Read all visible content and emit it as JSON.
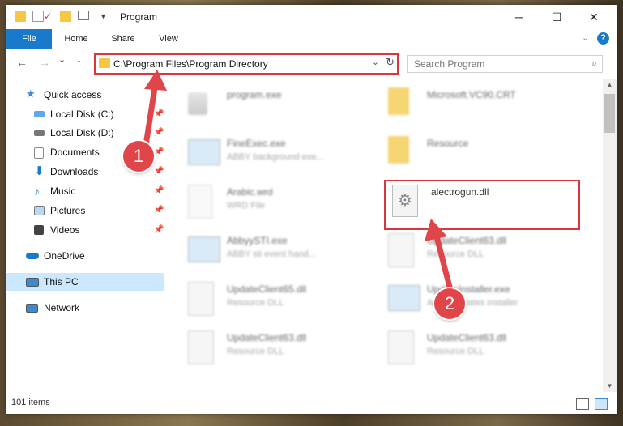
{
  "window": {
    "title": "Program",
    "controls": {
      "minimize": "─",
      "maximize": "☐",
      "close": "✕"
    }
  },
  "ribbon": {
    "tabs": [
      {
        "label": "File"
      },
      {
        "label": "Home"
      },
      {
        "label": "Share"
      },
      {
        "label": "View"
      }
    ],
    "help": "?"
  },
  "nav": {
    "back": "←",
    "forward": "→",
    "recent": "⌄",
    "up": "↑",
    "address": "C:\\Program Files\\Program Directory",
    "address_dropdown": "⌄",
    "refresh": "↻"
  },
  "search": {
    "placeholder": "Search Program",
    "icon": "⌕"
  },
  "sidebar": {
    "items": [
      {
        "label": "Quick access",
        "icon": "star-icon"
      },
      {
        "label": "Local Disk (C:)",
        "icon": "drive-icon",
        "pinned": true
      },
      {
        "label": "Local Disk (D:)",
        "icon": "drive-icon",
        "pinned": true
      },
      {
        "label": "Documents",
        "icon": "documents-icon",
        "pinned": true
      },
      {
        "label": "Downloads",
        "icon": "downloads-icon",
        "pinned": true
      },
      {
        "label": "Music",
        "icon": "music-icon",
        "pinned": true
      },
      {
        "label": "Pictures",
        "icon": "pictures-icon",
        "pinned": true
      },
      {
        "label": "Videos",
        "icon": "videos-icon",
        "pinned": true
      },
      {
        "label": "OneDrive",
        "icon": "cloud-icon"
      },
      {
        "label": "This PC",
        "icon": "computer-icon",
        "selected": true
      },
      {
        "label": "Network",
        "icon": "network-icon"
      }
    ]
  },
  "files": [
    {
      "name": "program.exe",
      "type": ""
    },
    {
      "name": "Microsoft.VC90.CRT",
      "type": ""
    },
    {
      "name": "FineExec.exe",
      "type": "ABBY background exe..."
    },
    {
      "name": "Resource",
      "type": ""
    },
    {
      "name": "Arabic.wrd",
      "type": "WRD File"
    },
    {
      "name": "alectrogun.dll",
      "type": ""
    },
    {
      "name": "AbbyySTI.exe",
      "type": "ABBY sti event hand..."
    },
    {
      "name": "UpdateClient63.dll",
      "type": "Resource DLL"
    },
    {
      "name": "UpdateClient65.dll",
      "type": "Resource DLL"
    },
    {
      "name": "UpdateInstaller.exe",
      "type": "ABBY updates installer"
    },
    {
      "name": "UpdateClient63.dll",
      "type": "Resource DLL"
    },
    {
      "name": "UpdateClient63.dll",
      "type": "Resource DLL"
    }
  ],
  "status": {
    "item_count": "101 items"
  },
  "annotations": {
    "step1": "1",
    "step2": "2"
  },
  "colors": {
    "accent": "#1979ca",
    "highlight": "#d9363e",
    "selected": "#cce8ff",
    "folder": "#f4c745"
  }
}
